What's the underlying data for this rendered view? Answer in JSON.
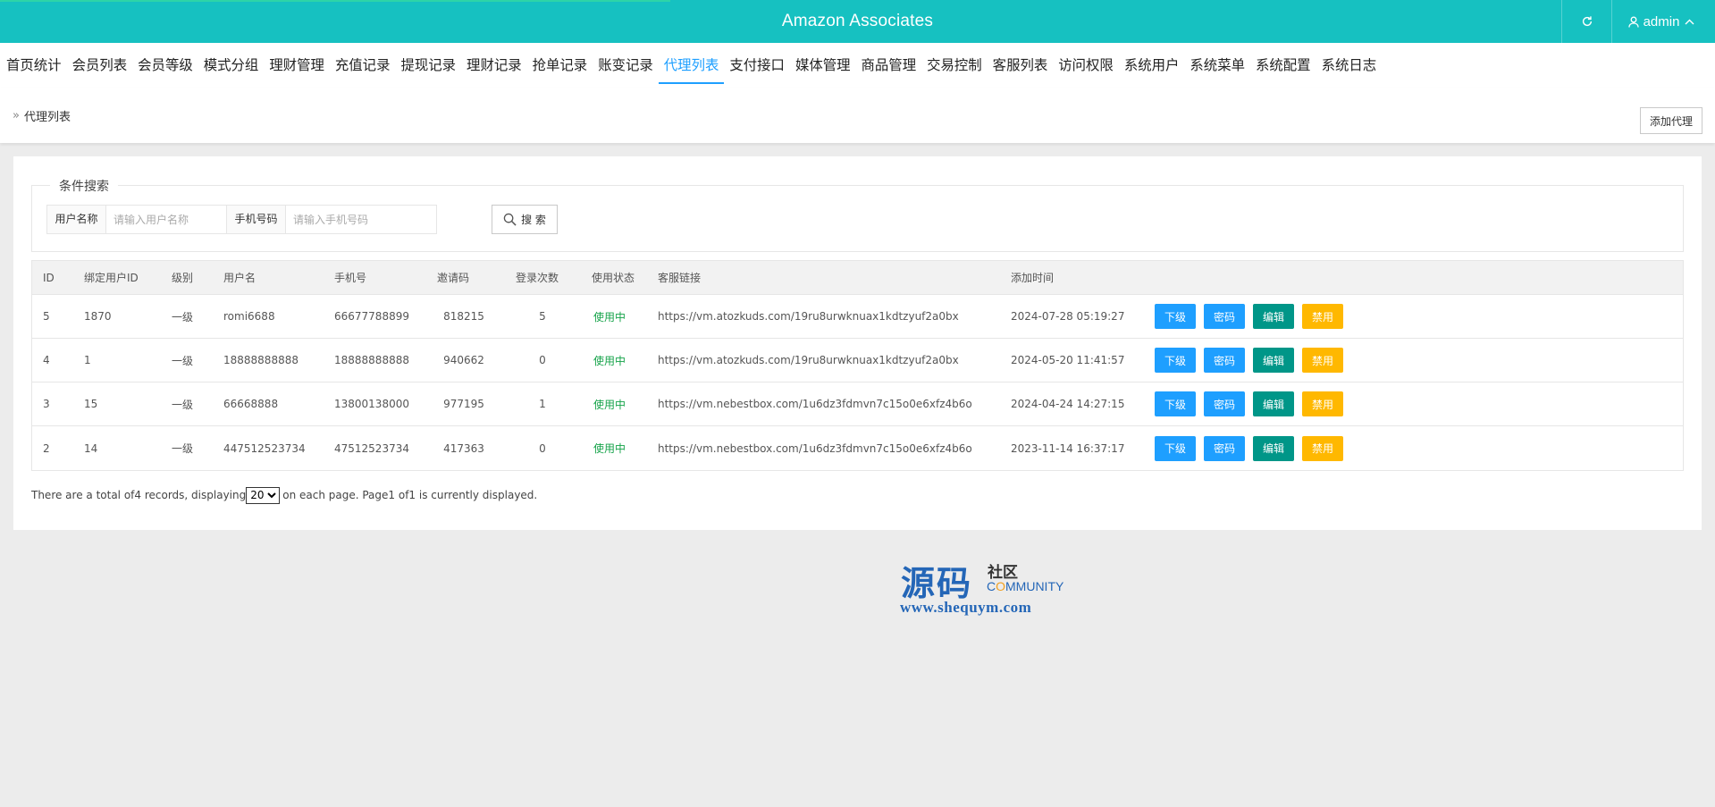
{
  "header": {
    "title": "Amazon Associates",
    "user": "admin"
  },
  "nav": {
    "items": [
      "首页统计",
      "会员列表",
      "会员等级",
      "模式分组",
      "理财管理",
      "充值记录",
      "提现记录",
      "理财记录",
      "抢单记录",
      "账变记录",
      "代理列表",
      "支付接口",
      "媒体管理",
      "商品管理",
      "交易控制",
      "客服列表",
      "访问权限",
      "系统用户",
      "系统菜单",
      "系统配置",
      "系统日志"
    ],
    "active": "代理列表"
  },
  "breadcrumb": {
    "label": "代理列表",
    "add_button": "添加代理"
  },
  "search": {
    "legend": "条件搜索",
    "username_label": "用户名称",
    "username_placeholder": "请输入用户名称",
    "phone_label": "手机号码",
    "phone_placeholder": "请输入手机号码",
    "button": "搜 索"
  },
  "table": {
    "headers": [
      "ID",
      "绑定用户ID",
      "级别",
      "用户名",
      "手机号",
      "邀请码",
      "登录次数",
      "使用状态",
      "客服链接",
      "添加时间"
    ],
    "rows": [
      {
        "id": "5",
        "bind_uid": "1870",
        "level": "一级",
        "username": "romi6688",
        "phone": "66677788899",
        "invite": "818215",
        "logins": "5",
        "status": "使用中",
        "link": "https://vm.atozkuds.com/19ru8urwknuax1kdtzyuf2a0bx",
        "time": "2024-07-28 05:19:27"
      },
      {
        "id": "4",
        "bind_uid": "1",
        "level": "一级",
        "username": "18888888888",
        "phone": "18888888888",
        "invite": "940662",
        "logins": "0",
        "status": "使用中",
        "link": "https://vm.atozkuds.com/19ru8urwknuax1kdtzyuf2a0bx",
        "time": "2024-05-20 11:41:57"
      },
      {
        "id": "3",
        "bind_uid": "15",
        "level": "一级",
        "username": "66668888",
        "phone": "13800138000",
        "invite": "977195",
        "logins": "1",
        "status": "使用中",
        "link": "https://vm.nebestbox.com/1u6dz3fdmvn7c15o0e6xfz4b6o",
        "time": "2024-04-24 14:27:15"
      },
      {
        "id": "2",
        "bind_uid": "14",
        "level": "一级",
        "username": "447512523734",
        "phone": "47512523734",
        "invite": "417363",
        "logins": "0",
        "status": "使用中",
        "link": "https://vm.nebestbox.com/1u6dz3fdmvn7c15o0e6xfz4b6o",
        "time": "2023-11-14 16:37:17"
      }
    ],
    "actions": [
      "下级",
      "密码",
      "编辑",
      "禁用"
    ]
  },
  "pager": {
    "prefix": "There are a total of4 records, displaying",
    "page_size": "20",
    "suffix": "on each page. Page1 of1 is currently displayed."
  },
  "watermark": {
    "big": "源码",
    "small": "社区",
    "community_a": "C",
    "community_b": "O",
    "community_c": "MMUNITY",
    "url": "www.shequym.com"
  },
  "colors": {
    "header": "#16c1c1",
    "accent": "#1e9fff",
    "edit": "#009688",
    "disable": "#ffb800",
    "status": "#16a34a"
  }
}
